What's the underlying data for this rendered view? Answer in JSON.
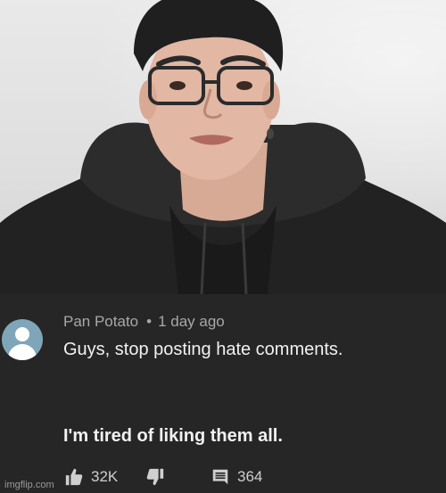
{
  "comment": {
    "author": "Pan Potato",
    "separator": "•",
    "time": "1 day ago",
    "text_line_1": "Guys, stop posting hate comments.",
    "text_line_2": "I'm tired of liking them all."
  },
  "actions": {
    "like_icon": "thumbs-up-icon",
    "like_count": "32K",
    "dislike_icon": "thumbs-down-icon",
    "reply_icon": "comment-icon",
    "reply_count": "364"
  },
  "watermark": "imgflip.com",
  "colors": {
    "panel_bg": "#262626",
    "avatar_bg": "#7fa5b8",
    "text_primary": "#f1f1f1",
    "text_secondary": "#a8a8a8"
  }
}
